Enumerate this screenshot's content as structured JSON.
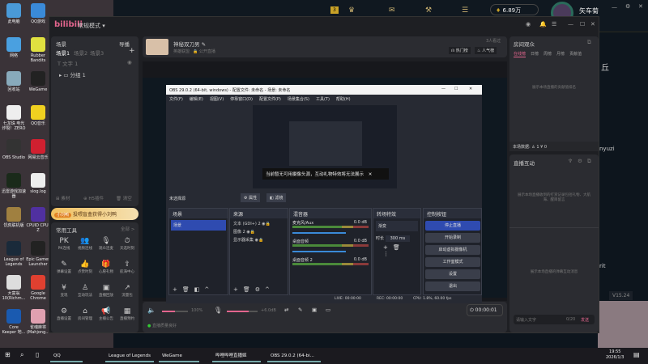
{
  "desktop": {
    "icons": [
      {
        "label": "此电脑",
        "color": "#4a9ad8"
      },
      {
        "label": "QQ游戏",
        "color": "#3a8ad8"
      },
      {
        "label": "网络",
        "color": "#4aa0e0"
      },
      {
        "label": "Rubber Bandits",
        "color": "#e0e040"
      },
      {
        "label": "回收站",
        "color": "#8ab"
      },
      {
        "label": "WeGame",
        "color": "#222"
      },
      {
        "label": "七龙珠 电光炸裂！ZERO",
        "color": "#eee"
      },
      {
        "label": "QQ音乐",
        "color": "#f0d020"
      },
      {
        "label": "OBS Studio",
        "color": "#333"
      },
      {
        "label": "网易云音乐",
        "color": "#d02030"
      },
      {
        "label": "迅雷游戏加速器",
        "color": "#1a2a1a"
      },
      {
        "label": "slog.log",
        "color": "#eee"
      },
      {
        "label": "饥荒联机版",
        "color": "#a08040"
      },
      {
        "label": "CPUID CPU-Z",
        "color": "#5030a0"
      },
      {
        "label": "League of Legends",
        "color": "#1a2a3a"
      },
      {
        "label": "Epic Games Launcher",
        "color": "#222"
      },
      {
        "label": "大富翁10(Richm...",
        "color": "#ddd"
      },
      {
        "label": "Google Chrome",
        "color": "#e04030"
      },
      {
        "label": "Core Keeper 地...",
        "color": "#1a5ab0"
      },
      {
        "label": "雀魂麻将(Mahjong...",
        "color": "#e0a0b0"
      }
    ]
  },
  "lol": {
    "badge": "3",
    "currency": "6.89万",
    "username": "矢车菊",
    "right_text": [
      "丘",
      "nyuzi",
      "rit"
    ],
    "version": "V15.24"
  },
  "bili": {
    "logo": "bilibili",
    "mode": "常规模式 ▾",
    "scenes": {
      "title": "场景",
      "import": "导播",
      "tabs": [
        "场景1",
        "场景2",
        "场景3"
      ],
      "text_source": "文字 1",
      "group": "分组 1",
      "footer": [
        "素材",
        "H5插件",
        "清空"
      ]
    },
    "promo": {
      "tag": "小刘鸭",
      "text": "投喂盲盒获得小刘鸭"
    },
    "tools": {
      "title": "常用工具",
      "all": "全部 >",
      "items": [
        {
          "icon": "PK",
          "label": "PK连线"
        },
        {
          "icon": "👥",
          "label": "视频连线"
        },
        {
          "icon": "🎙",
          "label": "观众连麦"
        },
        {
          "icon": "⏱",
          "label": "天选时刻"
        },
        {
          "icon": "✎",
          "label": "弹幕设置"
        },
        {
          "icon": "👍",
          "label": "点赞时刻"
        },
        {
          "icon": "🎁",
          "label": "心愿礼物"
        },
        {
          "icon": "⇪",
          "label": "航海中心"
        },
        {
          "icon": "¥",
          "label": "变现"
        },
        {
          "icon": "♙",
          "label": "互动玩法"
        },
        {
          "icon": "▣",
          "label": "直播回放"
        },
        {
          "icon": "↗",
          "label": "流量包"
        },
        {
          "icon": "⚙",
          "label": "直播设置"
        },
        {
          "icon": "⌂",
          "label": "房间管理"
        },
        {
          "icon": "📢",
          "label": "主播公告"
        },
        {
          "icon": "▦",
          "label": "直播预约"
        }
      ]
    },
    "room": {
      "title": "神秘双刀男",
      "category": "英雄联盟",
      "visibility": "公开直播",
      "viewers": "3人看过",
      "hot_rank": "热门榜",
      "pop_rank": "人气榜"
    },
    "audience": {
      "title": "房间观众",
      "tabs": [
        "在线榜",
        "日榜",
        "周榜",
        "月榜",
        "贡献值"
      ],
      "empty": "展示本场直播的贡献值排名",
      "stats_label": "本场数据:",
      "stats_people": "1",
      "stats_coin": "0"
    },
    "interact": {
      "title": "直播互动",
      "empty1": "展示本场直播收到的打赏记录包括礼物、大航海、醒目留言",
      "empty2": "展示本场直播的弹幕互动消息",
      "input_placeholder": "请输入文字",
      "count": "0/20",
      "send": "发送"
    },
    "bottom": {
      "speaker_vol": "100%",
      "mic_vol": "+6.0dB",
      "timer": "00:00:01",
      "status": "直播质量良好",
      "speaker_level": 0.5,
      "mic_level": 0.7
    }
  },
  "obs": {
    "title": "OBS 29.0.2 (64-bit, windows) - 配置文件: 未命名 - 场景: 未命名",
    "menu": [
      "文件(F)",
      "编辑(E)",
      "视图(V)",
      "停靠窗口(D)",
      "配置文件(P)",
      "场景集合(S)",
      "工具(T)",
      "帮助(H)"
    ],
    "toast": "当前暂无可用摄像头源，互动礼物特效将无法展示",
    "no_source": "未选择源",
    "properties": "属性",
    "filters": "滤镜",
    "docks": {
      "scenes": "场景",
      "sources": "来源",
      "mixer": "混音器",
      "transitions": "转场特效",
      "controls": "控制按钮"
    },
    "scene_items": [
      "场景"
    ],
    "sources": [
      "文本 (GDI+) 2",
      "图像 2",
      "显示器采集"
    ],
    "mixer": [
      {
        "name": "麦克风/Aux",
        "db": "0.0 dB"
      },
      {
        "name": "桌面音频",
        "db": "0.0 dB"
      },
      {
        "name": "桌面音频 2",
        "db": "0.0 dB"
      }
    ],
    "transition": "渐变",
    "duration_label": "时长",
    "duration": "300 ms",
    "controls": [
      "停止直播",
      "开始录制",
      "启动虚拟摄像机",
      "工作室模式",
      "设置",
      "退出"
    ],
    "status": {
      "live": "LIVE: 00:00:00",
      "rec": "REC: 00:00:00",
      "cpu": "CPU: 1.8%, 60.00 fps"
    }
  },
  "taskbar": {
    "items": [
      "QQ",
      "League of Legends",
      "WeGame",
      "哔哩哔哩直播姬",
      "OBS 29.0.2 (64-bi..."
    ],
    "time": "19:55",
    "date": "2026/1/3"
  }
}
